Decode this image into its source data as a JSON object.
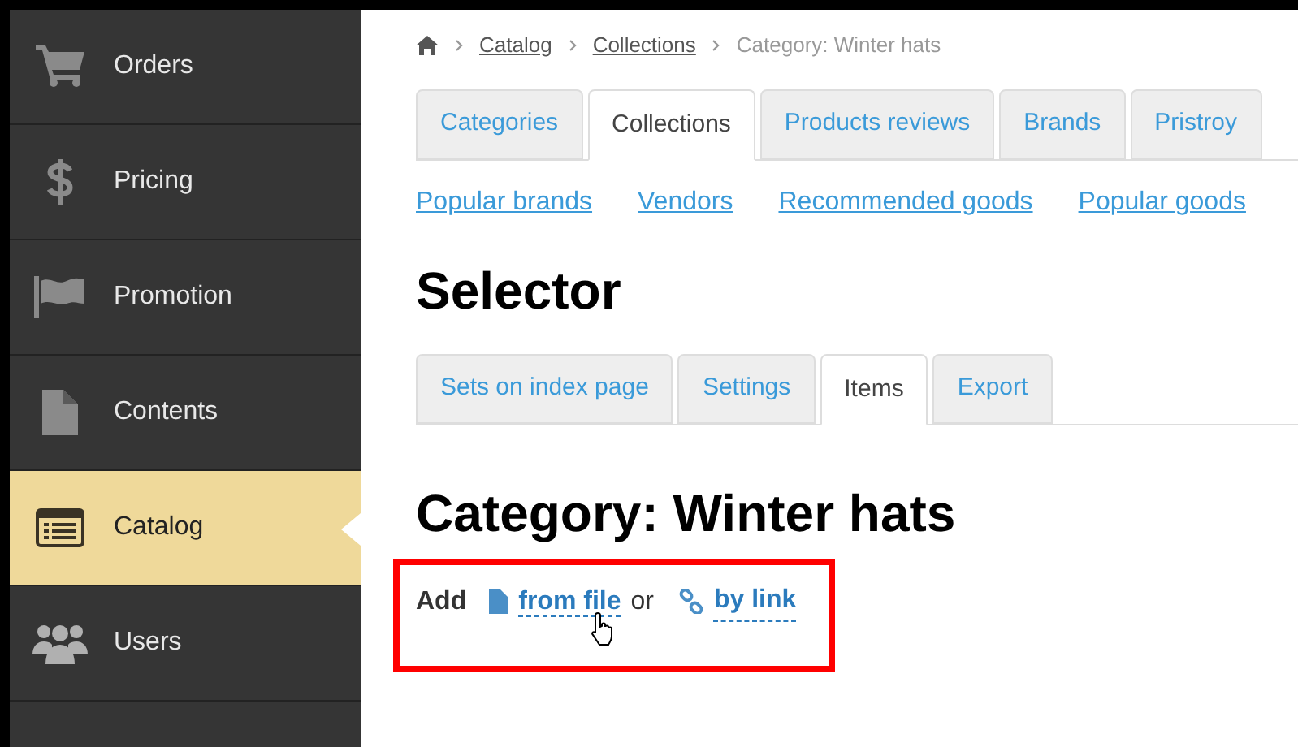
{
  "sidebar": {
    "items": [
      {
        "label": "Orders",
        "selected": false
      },
      {
        "label": "Pricing",
        "selected": false
      },
      {
        "label": "Promotion",
        "selected": false
      },
      {
        "label": "Contents",
        "selected": false
      },
      {
        "label": "Catalog",
        "selected": true
      },
      {
        "label": "Users",
        "selected": false
      }
    ]
  },
  "breadcrumb": {
    "links": [
      "Catalog",
      "Collections"
    ],
    "current": "Category: Winter hats"
  },
  "tabs": [
    {
      "label": "Categories",
      "selected": false
    },
    {
      "label": "Collections",
      "selected": true
    },
    {
      "label": "Products reviews",
      "selected": false
    },
    {
      "label": "Brands",
      "selected": false
    },
    {
      "label": "Pristroy",
      "selected": false
    }
  ],
  "sublinks": [
    "Popular brands",
    "Vendors",
    "Recommended goods",
    "Popular goods"
  ],
  "title": "Selector",
  "subtabs": [
    {
      "label": "Sets on index page",
      "selected": false
    },
    {
      "label": "Settings",
      "selected": false
    },
    {
      "label": "Items",
      "selected": true
    },
    {
      "label": "Export",
      "selected": false
    }
  ],
  "heading": "Category: Winter hats",
  "add": {
    "label": "Add",
    "from_file": "from file",
    "or": "or",
    "by_link": "by link"
  }
}
